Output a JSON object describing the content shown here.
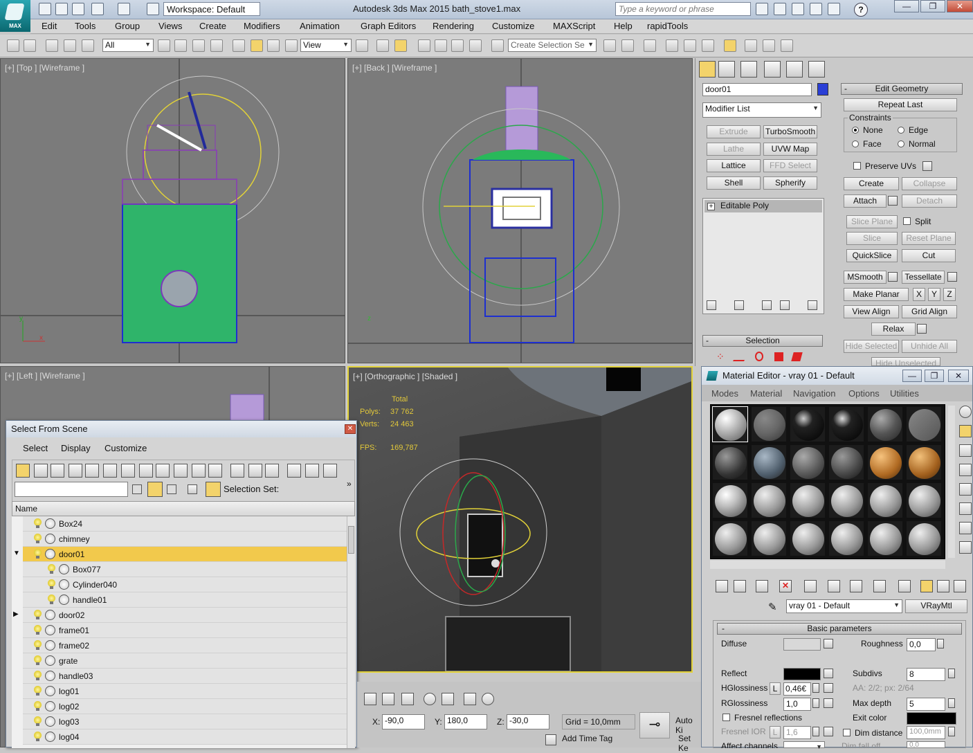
{
  "title_bar": {
    "logo_text": "MAX",
    "workspace": "Workspace: Default",
    "app_title": "Autodesk 3ds Max  2015     bath_stove1.max",
    "search_placeholder": "Type a keyword or phrase",
    "help_glyph": "?",
    "win_min": "—",
    "win_max": "❐",
    "win_close": "✕"
  },
  "menu": [
    "Edit",
    "Tools",
    "Group",
    "Views",
    "Create",
    "Modifiers",
    "Animation",
    "Graph Editors",
    "Rendering",
    "Customize",
    "MAXScript",
    "Help",
    "rapidTools"
  ],
  "toolbar": {
    "filter": "All",
    "coord": "View",
    "selection_set": "Create Selection Se"
  },
  "viewports": {
    "top": "[+] [Top ] [Wireframe ]",
    "back": "[+] [Back ] [Wireframe ]",
    "left": "[+] [Left ] [Wireframe ]",
    "ortho": "[+] [Orthographic ] [Shaded ]",
    "stats": {
      "total_label": "Total",
      "polys_label": "Polys:",
      "polys": "37 762",
      "verts_label": "Verts:",
      "verts": "24 463",
      "fps_label": "FPS:",
      "fps": "169,787"
    },
    "axis_x": "x",
    "axis_y": "y",
    "axis_z": "z"
  },
  "command_panel": {
    "object_name": "door01",
    "object_color": "#2a3fd6",
    "modifier_list": "Modifier List",
    "modifier_buttons": [
      {
        "label": "Extrude",
        "enabled": false
      },
      {
        "label": "TurboSmooth",
        "enabled": true
      },
      {
        "label": "Lathe",
        "enabled": false
      },
      {
        "label": "UVW Map",
        "enabled": true
      },
      {
        "label": "Lattice",
        "enabled": true
      },
      {
        "label": "FFD Select",
        "enabled": false
      },
      {
        "label": "Shell",
        "enabled": true
      },
      {
        "label": "Spherify",
        "enabled": true
      }
    ],
    "stack_item": "Editable Poly",
    "stack_expand": "+",
    "selection_rollout": "Selection",
    "rollout_collapse": "-",
    "edit_geometry": "Edit Geometry",
    "repeat_last": "Repeat Last",
    "constraints": "Constraints",
    "constraint_options": [
      "None",
      "Edge",
      "Face",
      "Normal"
    ],
    "preserve_uvs": "Preserve UVs",
    "geo_buttons": [
      {
        "label": "Create",
        "enabled": true
      },
      {
        "label": "Collapse",
        "enabled": false
      },
      {
        "label": "Attach",
        "enabled": true
      },
      {
        "label": "Detach",
        "enabled": false
      },
      {
        "label": "Slice Plane",
        "enabled": false
      },
      {
        "label": "Split",
        "enabled": true
      },
      {
        "label": "Slice",
        "enabled": false
      },
      {
        "label": "Reset Plane",
        "enabled": false
      },
      {
        "label": "QuickSlice",
        "enabled": true
      },
      {
        "label": "Cut",
        "enabled": true
      },
      {
        "label": "MSmooth",
        "enabled": true
      },
      {
        "label": "Tessellate",
        "enabled": true
      },
      {
        "label": "Make Planar",
        "enabled": true
      },
      {
        "label": "X",
        "enabled": true
      },
      {
        "label": "Y",
        "enabled": true
      },
      {
        "label": "Z",
        "enabled": true
      },
      {
        "label": "View Align",
        "enabled": true
      },
      {
        "label": "Grid Align",
        "enabled": true
      },
      {
        "label": "Relax",
        "enabled": true
      },
      {
        "label": "Hide Selected",
        "enabled": false
      },
      {
        "label": "Unhide All",
        "enabled": false
      },
      {
        "label": "Hide Unselected",
        "enabled": false
      }
    ]
  },
  "select_from_scene": {
    "title": "Select From Scene",
    "close": "✕",
    "menu": [
      "Select",
      "Display",
      "Customize"
    ],
    "selection_set_label": "Selection Set:",
    "more": "»",
    "column_name": "Name",
    "expanded_glyph": "▼",
    "collapsed_glyph": "▶",
    "rows": [
      {
        "name": "Box24",
        "indent": 0,
        "selected": false,
        "expander": ""
      },
      {
        "name": "chimney",
        "indent": 0,
        "selected": false,
        "expander": ""
      },
      {
        "name": "door01",
        "indent": 0,
        "selected": true,
        "expander": "open"
      },
      {
        "name": "Box077",
        "indent": 1,
        "selected": false,
        "expander": ""
      },
      {
        "name": "Cylinder040",
        "indent": 1,
        "selected": false,
        "expander": ""
      },
      {
        "name": "handle01",
        "indent": 1,
        "selected": false,
        "expander": ""
      },
      {
        "name": "door02",
        "indent": 0,
        "selected": false,
        "expander": "closed"
      },
      {
        "name": "frame01",
        "indent": 0,
        "selected": false,
        "expander": ""
      },
      {
        "name": "frame02",
        "indent": 0,
        "selected": false,
        "expander": ""
      },
      {
        "name": "grate",
        "indent": 0,
        "selected": false,
        "expander": ""
      },
      {
        "name": "handle03",
        "indent": 0,
        "selected": false,
        "expander": ""
      },
      {
        "name": "log01",
        "indent": 0,
        "selected": false,
        "expander": ""
      },
      {
        "name": "log02",
        "indent": 0,
        "selected": false,
        "expander": ""
      },
      {
        "name": "log03",
        "indent": 0,
        "selected": false,
        "expander": ""
      },
      {
        "name": "log04",
        "indent": 0,
        "selected": false,
        "expander": ""
      }
    ]
  },
  "material_editor": {
    "title": "Material Editor - vray 01 - Default",
    "menu": [
      "Modes",
      "Material",
      "Navigation",
      "Options",
      "Utilities"
    ],
    "material_name": "vray 01 - Default",
    "material_type": "VRayMtl",
    "basic_params": "Basic parameters",
    "collapse": "-",
    "diffuse": "Diffuse",
    "roughness": "Roughness",
    "roughness_value": "0,0",
    "reflect": "Reflect",
    "subdivs": "Subdivs",
    "subdivs_value": "8",
    "hglossiness": "HGlossiness",
    "lock": "L",
    "hgloss_value": "0,46€",
    "aa_info": "AA: 2/2; px: 2/64",
    "rglossiness": "RGlossiness",
    "rgloss_value": "1,0",
    "max_depth": "Max depth",
    "max_depth_value": "5",
    "fresnel": "Fresnel reflections",
    "exit_color": "Exit color",
    "fresnel_ior": "Fresnel IOR",
    "fresnel_ior_value": "1,6",
    "dim_distance": "Dim distance",
    "dim_distance_value": "100,0mm",
    "affect_channels": "Affect channels",
    "dim_falloff": "Dim fall off",
    "dim_falloff_value": "0,0",
    "reflect_color": "#000000",
    "exit_color_value": "#000000",
    "diffuse_color": "#d8d8d8"
  },
  "status": {
    "x_label": "X:",
    "x": "-90,0",
    "y_label": "Y:",
    "y": "180,0",
    "z_label": "Z:",
    "z": "-30,0",
    "grid": "Grid = 10,0mm",
    "add_time_tag": "Add Time Tag",
    "auto_key": "Auto Ki",
    "set_key": "Set Ke"
  }
}
